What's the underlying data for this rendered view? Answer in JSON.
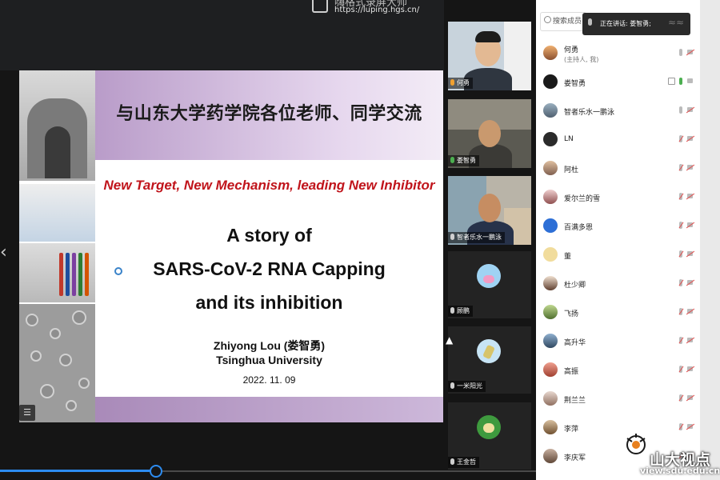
{
  "recorder": {
    "title": "嗨格式录屏大师",
    "url": "https://luping.hgs.cn/"
  },
  "slide": {
    "heading": "与山东大学药学院各位老师、同学交流",
    "subtitle": "New Target, New Mechanism, leading New Inhibitor",
    "title_lines": [
      "A story of",
      "SARS-CoV-2 RNA Capping",
      "and its inhibition"
    ],
    "presenter_name": "Zhiyong Lou (娄智勇)",
    "presenter_affiliation": "Tsinghua University",
    "date": "2022. 11. 09"
  },
  "playback": {
    "progress": 0.29
  },
  "video_tiles": [
    {
      "name": "何勇",
      "type": "camera"
    },
    {
      "name": "娄智勇",
      "type": "camera"
    },
    {
      "name": "智者乐水一鹏泳",
      "type": "camera"
    },
    {
      "name": "顾鹏",
      "type": "avatar"
    },
    {
      "name": "一米阳光",
      "type": "avatar"
    },
    {
      "name": "王金哲",
      "type": "avatar"
    }
  ],
  "panel": {
    "search_placeholder": "搜索成员",
    "speaking_label": "正在讲话: 娄智勇;",
    "participants": [
      {
        "name": "何勇",
        "sub": "(主持人, 我)",
        "mic": "on",
        "cam": "muted"
      },
      {
        "name": "娄智勇",
        "sub": "",
        "mic": "active",
        "cam": "on"
      },
      {
        "name": "智者乐水一鹏泳",
        "sub": "",
        "mic": "on",
        "cam": "muted"
      },
      {
        "name": "LN",
        "sub": "",
        "mic": "muted",
        "cam": "muted"
      },
      {
        "name": "阿杜",
        "sub": "",
        "mic": "muted",
        "cam": "muted"
      },
      {
        "name": "爱尔兰的雪",
        "sub": "",
        "mic": "muted",
        "cam": "muted"
      },
      {
        "name": "百满多恩",
        "sub": "",
        "mic": "muted",
        "cam": "muted"
      },
      {
        "name": "董",
        "sub": "",
        "mic": "muted",
        "cam": "muted"
      },
      {
        "name": "杜少卿",
        "sub": "",
        "mic": "muted",
        "cam": "muted"
      },
      {
        "name": "飞扬",
        "sub": "",
        "mic": "muted",
        "cam": "muted"
      },
      {
        "name": "高升华",
        "sub": "",
        "mic": "muted",
        "cam": "muted"
      },
      {
        "name": "高振",
        "sub": "",
        "mic": "muted",
        "cam": "muted"
      },
      {
        "name": "荆兰兰",
        "sub": "",
        "mic": "muted",
        "cam": "muted"
      },
      {
        "name": "李萍",
        "sub": "",
        "mic": "muted",
        "cam": "muted"
      },
      {
        "name": "李庆军",
        "sub": "",
        "mic": "muted",
        "cam": "muted"
      }
    ]
  },
  "watermark": {
    "brand": "山大视点",
    "url": "view.sdu.edu.cn"
  },
  "colors": {
    "accent": "#2d8cf0",
    "slide_band": "#b99cc9",
    "subtitle_red": "#c0141b"
  }
}
